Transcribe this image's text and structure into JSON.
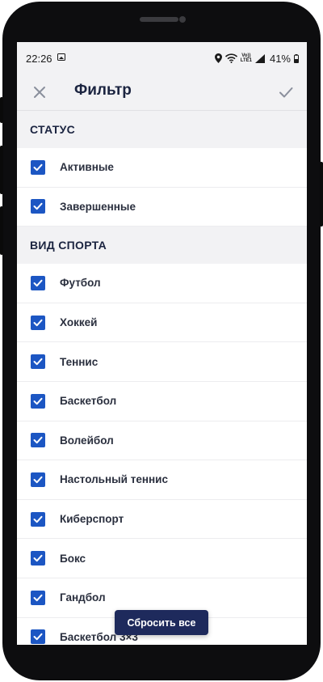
{
  "status_bar": {
    "time": "22:26",
    "volte_line1": "Vo))",
    "volte_line2": "LTE1",
    "battery_text": "41%"
  },
  "header": {
    "title": "Фильтр",
    "close_icon": "close-icon",
    "confirm_icon": "check-icon"
  },
  "sections": [
    {
      "title": "СТАТУС",
      "items": [
        {
          "label": "Активные",
          "checked": true
        },
        {
          "label": "Завершенные",
          "checked": true
        }
      ]
    },
    {
      "title": "ВИД СПОРТА",
      "items": [
        {
          "label": "Футбол",
          "checked": true
        },
        {
          "label": "Хоккей",
          "checked": true
        },
        {
          "label": "Теннис",
          "checked": true
        },
        {
          "label": "Баскетбол",
          "checked": true
        },
        {
          "label": "Волейбол",
          "checked": true
        },
        {
          "label": "Настольный теннис",
          "checked": true
        },
        {
          "label": "Киберспорт",
          "checked": true
        },
        {
          "label": "Бокс",
          "checked": true
        },
        {
          "label": "Гандбол",
          "checked": true
        },
        {
          "label": "Баскетбол 3×3",
          "checked": true
        }
      ]
    }
  ],
  "reset_button": {
    "label": "Сбросить все"
  },
  "colors": {
    "checkbox": "#1c56c3",
    "title_text": "#1b2440",
    "section_bg": "#f2f2f4",
    "button_bg": "#1e2a5c"
  }
}
